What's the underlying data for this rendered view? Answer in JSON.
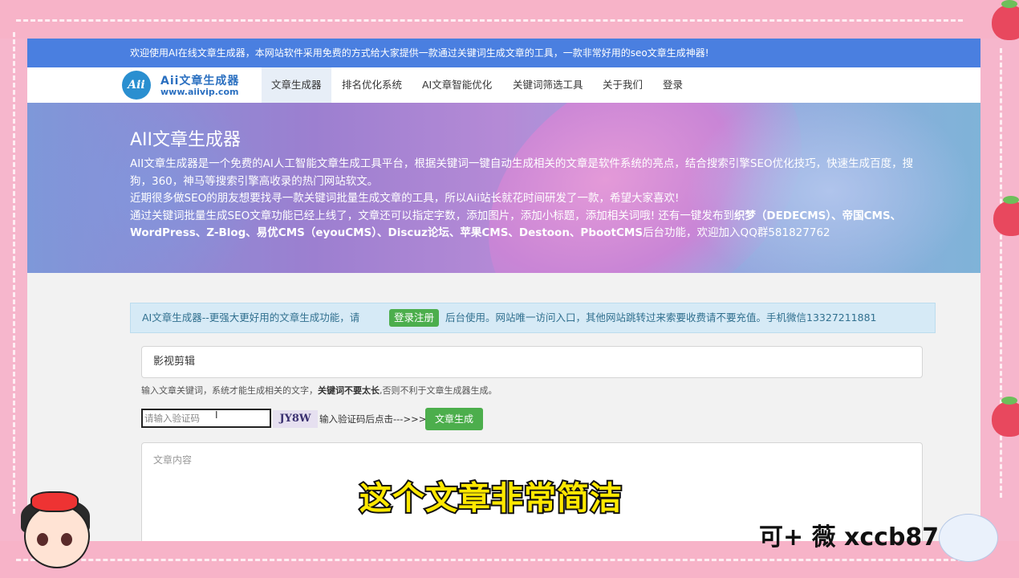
{
  "topbar": {
    "text": "欢迎使用AI在线文章生成器，本网站软件采用免费的方式给大家提供一款通过关键词生成文章的工具，一款非常好用的seo文章生成神器!"
  },
  "logo": {
    "circle_text": "Aii",
    "title": "Aii文章生成器",
    "domain": "www.aiivip.com"
  },
  "nav": {
    "items": [
      "文章生成器",
      "排名优化系统",
      "AI文章智能优化",
      "关键词筛选工具",
      "关于我们",
      "登录"
    ]
  },
  "hero": {
    "title": "AII文章生成器",
    "p1": "AII文章生成器是一个免费的AI人工智能文章生成工具平台，根据关键词一键自动生成相关的文章是软件系统的亮点，结合搜索引擎SEO优化技巧，快速生成百度，搜狗，360，神马等搜索引擎高收录的热门网站软文。",
    "p2": "近期很多做SEO的朋友想要找寻一款关键词批量生成文章的工具，所以Aii站长就花时间研发了一款，希望大家喜欢!",
    "p3_prefix": "通过关键词批量生成SEO文章功能已经上线了，文章还可以指定字数，添加图片，添加小标题，添加相关词哦! 还有一键发布到",
    "p3_bold": "织梦（DEDECMS）、帝国CMS、WordPress、Z-Blog、易优CMS（eyouCMS）、Discuz论坛、苹果CMS、Destoon、PbootCMS",
    "p3_suffix": "后台功能，欢迎加入QQ群581827762"
  },
  "notice": {
    "text_before": "AI文章生成器--更强大更好用的文章生成功能，请",
    "button": "登录注册",
    "text_after": "后台使用。网站唯一访问入口，其他网站跳转过来索要收费请不要充值。手机微信13327211881"
  },
  "form": {
    "keyword_value": "影视剪辑",
    "hint_prefix": "输入文章关键词，系统才能生成相关的文字，",
    "hint_bold": "关键词不要太长",
    "hint_suffix": ",否则不利于文章生成器生成。",
    "captcha_placeholder": "请输入验证码",
    "captcha_code": "JY8W",
    "captcha_hint": "输入验证码后点击--->>>",
    "generate_button": "文章生成",
    "content_placeholder": "文章内容"
  },
  "overlay": {
    "caption": "这个文章非常简洁",
    "wechat": "可+ 薇 xccb8787"
  },
  "colors": {
    "topbar": "#4a7fe0",
    "frame": "#f7b3c8",
    "button_green": "#4cae4c",
    "caption_yellow": "#ffe800"
  }
}
